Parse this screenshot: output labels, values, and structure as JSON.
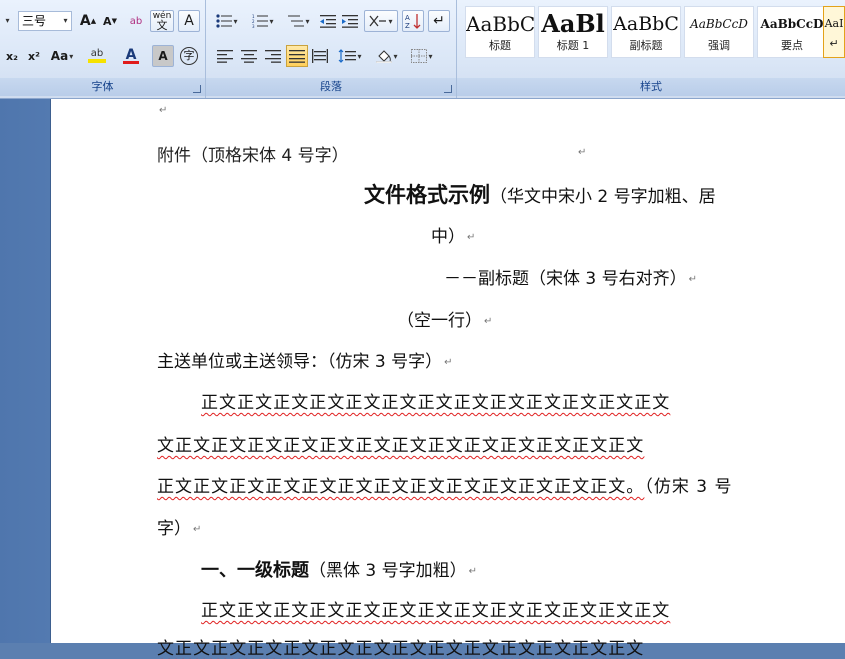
{
  "ribbon": {
    "font_group": {
      "title": "字体",
      "font_size": "三号",
      "grow_font": "A",
      "shrink_font": "A",
      "clear_format": "ab",
      "phonetic": "wén",
      "char_border": "A",
      "subscript": "x₂",
      "superscript": "x²",
      "change_case": "Aa",
      "highlight": "ab",
      "font_color": "A",
      "char_shading": "A",
      "enclose": "字"
    },
    "paragraph_group": {
      "title": "段落"
    },
    "styles_group": {
      "title": "样式",
      "tiles": [
        {
          "sample": "AaBbC",
          "label": "标题"
        },
        {
          "sample": "AaBl",
          "label": "标题 1"
        },
        {
          "sample": "AaBbC",
          "label": "副标题"
        },
        {
          "sample": "AaBbCcD",
          "label": "强调"
        },
        {
          "sample": "AaBbCcD",
          "label": "要点"
        },
        {
          "sample": "AaI",
          "label": "↵"
        }
      ]
    },
    "colors": {
      "highlight": "#f6e200",
      "font_color": "#e01b1b",
      "accent": "#15428b"
    }
  },
  "document": {
    "lines": [
      "↵",
      "附件（顶格宋体 4 号字）",
      "↵",
      "文件格式示例",
      "（华文中宋小 2 号字加粗、居",
      "中）",
      "－－副标题（宋体 3 号右对齐）",
      "（空一行）",
      "主送单位或主送领导：（仿宋 3 号字）",
      "正文正文正文正文正文正文正文正文正文正文正文正文正文",
      "文正文正文正文正文正文正文正文正文正文正文正文正文正文",
      "正文正文正文正文正文正文正文正文正文正文正文正文正文。",
      "（仿宋 3 号",
      "字）",
      "一、一级标题",
      "（黑体 3 号字加粗）",
      "正文正文正文正文正文正文正文正文正文正文正文正文正文"
    ],
    "para_mark": "↵"
  }
}
